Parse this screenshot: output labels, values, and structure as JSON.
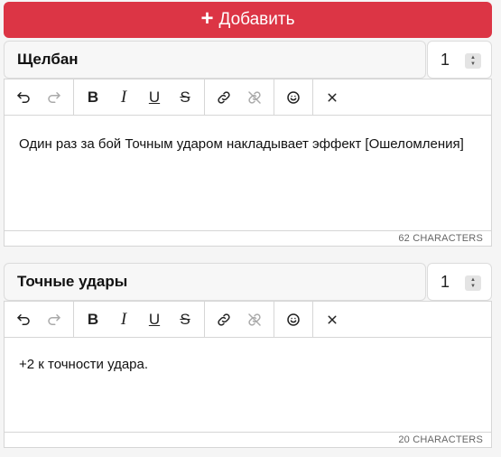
{
  "add_button": {
    "label": "Добавить",
    "icon": "plus-icon"
  },
  "toolbar": {
    "icons": [
      "undo-icon",
      "redo-icon",
      "bold-icon",
      "italic-icon",
      "underline-icon",
      "strikethrough-icon",
      "link-icon",
      "unlink-icon",
      "emoji-icon",
      "clear-icon"
    ],
    "bold": "B",
    "italic": "I",
    "underline": "U",
    "strike": "S"
  },
  "cards": [
    {
      "name": "Щелбан",
      "quantity": "1",
      "text": "Один раз за бой Точным ударом накладывает эффект [Ошеломления]",
      "char_count": "62 CHARACTERS"
    },
    {
      "name": "Точные удары",
      "quantity": "1",
      "text": "+2 к точности удара.",
      "char_count": "20 CHARACTERS"
    }
  ],
  "colors": {
    "accent": "#dc3545",
    "border": "#d6d6d6",
    "disabled": "#aaaaaa"
  }
}
